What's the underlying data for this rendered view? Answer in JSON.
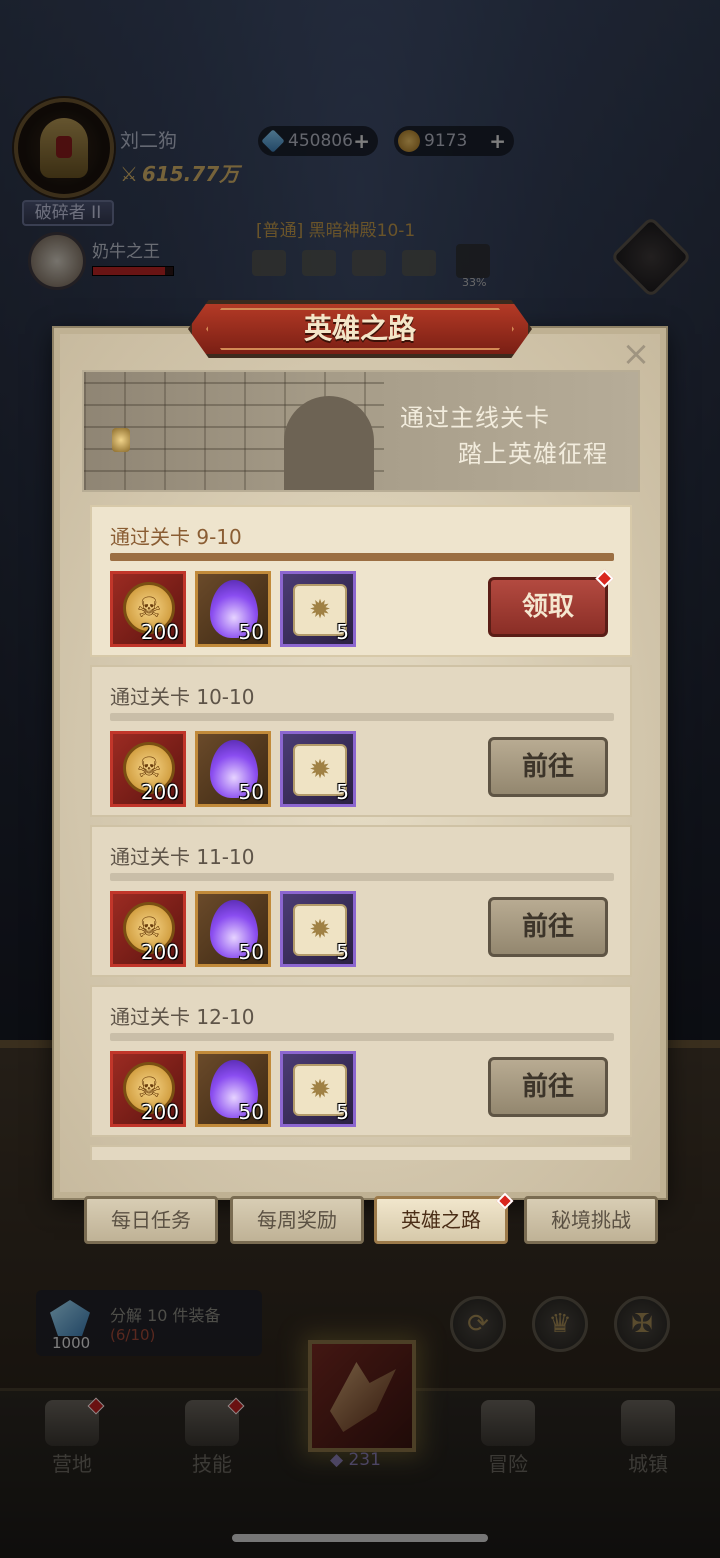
{
  "hud": {
    "player_name": "刘二狗",
    "power": "615.77万",
    "rank": "破碎者 II",
    "gems": "450806",
    "coins": "9173",
    "pet_name": "奶牛之王",
    "pet_hp_fraction": 0.9,
    "stage": "[普通] 黑暗神殿10-1",
    "stage_progress": "33%"
  },
  "modal": {
    "title": "英雄之路",
    "close": "×",
    "banner_line1": "通过主线关卡",
    "banner_line2": "踏上英雄征程",
    "tasks": [
      {
        "title": "通过关卡 9-10",
        "progress": 1.0,
        "rewards": [
          "200",
          "50",
          "5"
        ],
        "action": "领取"
      },
      {
        "title": "通过关卡 10-10",
        "progress": 0.0,
        "rewards": [
          "200",
          "50",
          "5"
        ],
        "action": "前往"
      },
      {
        "title": "通过关卡 11-10",
        "progress": 0.0,
        "rewards": [
          "200",
          "50",
          "5"
        ],
        "action": "前往"
      },
      {
        "title": "通过关卡 12-10",
        "progress": 0.0,
        "rewards": [
          "200",
          "50",
          "5"
        ],
        "action": "前往"
      }
    ],
    "tabs": [
      "每日任务",
      "每周奖励",
      "英雄之路",
      "秘境挑战"
    ],
    "active_tab": "英雄之路"
  },
  "bottom": {
    "gem_count": "1000",
    "task_text": "分解 10 件装备",
    "task_progress": "(6/10)",
    "hero_count": "231",
    "nav": [
      "营地",
      "技能",
      "冒险",
      "城镇"
    ]
  },
  "colors": {
    "claim_button": "#b34a40",
    "go_button": "#b8ab92",
    "modal_bg": "#d9cdb2",
    "title_plate": "#b43a26"
  }
}
